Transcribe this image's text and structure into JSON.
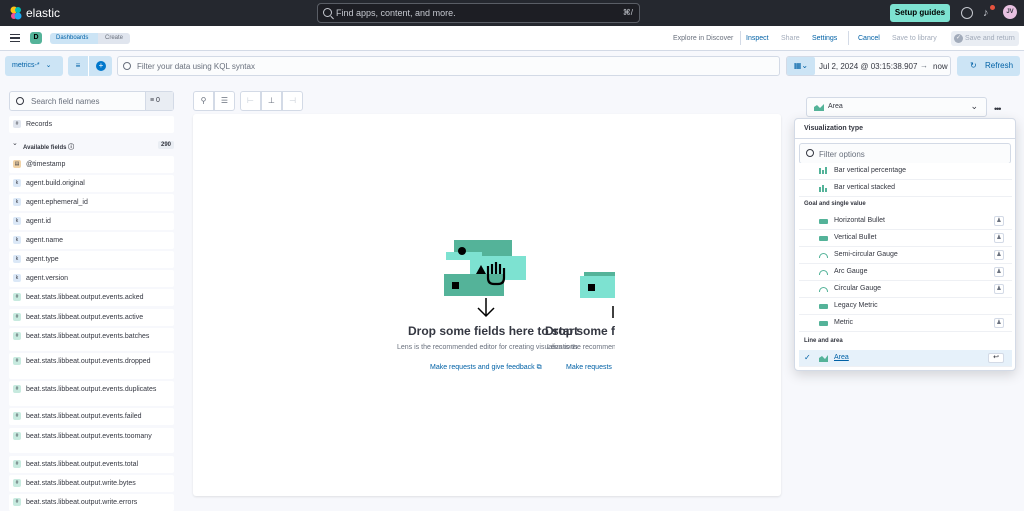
{
  "topbar": {
    "brand": "elastic",
    "search_placeholder": "Find apps, content, and more.",
    "search_shortcut": "⌘/",
    "setup_guides": "Setup guides",
    "avatar_initials": "JV"
  },
  "header": {
    "space_initial": "D",
    "breadcrumbs": [
      "Dashboards",
      "Create"
    ],
    "actions": {
      "explore": "Explore in Discover",
      "inspect": "Inspect",
      "share": "Share",
      "settings": "Settings",
      "cancel": "Cancel",
      "save_library": "Save to library",
      "save_return": "Save and return"
    }
  },
  "querybar": {
    "dataview": "metrics-*",
    "kql_placeholder": "Filter your data using KQL syntax",
    "date_start": "Jul 2, 2024 @ 03:15:38.907",
    "date_arrow": "→",
    "date_end": "now",
    "refresh": "Refresh"
  },
  "fields": {
    "search_placeholder": "Search field names",
    "filter_count": "0",
    "records_label": "Records",
    "available_label": "Available fields",
    "available_count": "290",
    "items": [
      {
        "type": "date",
        "name": "@timestamp"
      },
      {
        "type": "k",
        "name": "agent.build.original"
      },
      {
        "type": "k",
        "name": "agent.ephemeral_id"
      },
      {
        "type": "k",
        "name": "agent.id"
      },
      {
        "type": "k",
        "name": "agent.name"
      },
      {
        "type": "k",
        "name": "agent.type"
      },
      {
        "type": "k",
        "name": "agent.version"
      },
      {
        "type": "num",
        "name": "beat.stats.libbeat.output.events.acked"
      },
      {
        "type": "num",
        "name": "beat.stats.libbeat.output.events.active"
      },
      {
        "type": "num",
        "name": "beat.stats.libbeat.output.events.batches"
      },
      {
        "type": "num",
        "name": "beat.stats.libbeat.output.events.dropped"
      },
      {
        "type": "num",
        "name": "beat.stats.libbeat.output.events.duplicates"
      },
      {
        "type": "num",
        "name": "beat.stats.libbeat.output.events.failed"
      },
      {
        "type": "num",
        "name": "beat.stats.libbeat.output.events.toomany"
      },
      {
        "type": "num",
        "name": "beat.stats.libbeat.output.events.total"
      },
      {
        "type": "num",
        "name": "beat.stats.libbeat.output.write.bytes"
      },
      {
        "type": "num",
        "name": "beat.stats.libbeat.output.write.errors"
      }
    ]
  },
  "workspace": {
    "drop_title": "Drop some fields here to start",
    "drop_title_2": "Drop some fields here to start",
    "drop_sub": "Lens is the recommended editor for creating visualizations",
    "feedback": "Make requests and give feedback",
    "feedback_2": "Make requests"
  },
  "viz": {
    "selected": "Area",
    "popover_title": "Visualization type",
    "filter_placeholder": "Filter options",
    "options_top": [
      "Bar vertical percentage",
      "Bar vertical stacked"
    ],
    "group_goal": "Goal and single value",
    "goal_options": [
      "Horizontal Bullet",
      "Vertical Bullet",
      "Semi-circular Gauge",
      "Arc Gauge",
      "Circular Gauge",
      "Legacy Metric",
      "Metric"
    ],
    "group_line": "Line and area",
    "line_options": [
      "Area"
    ],
    "colors": {
      "accent": "#0077cc",
      "teal": "#54b399",
      "mint": "#7de2d1"
    }
  }
}
